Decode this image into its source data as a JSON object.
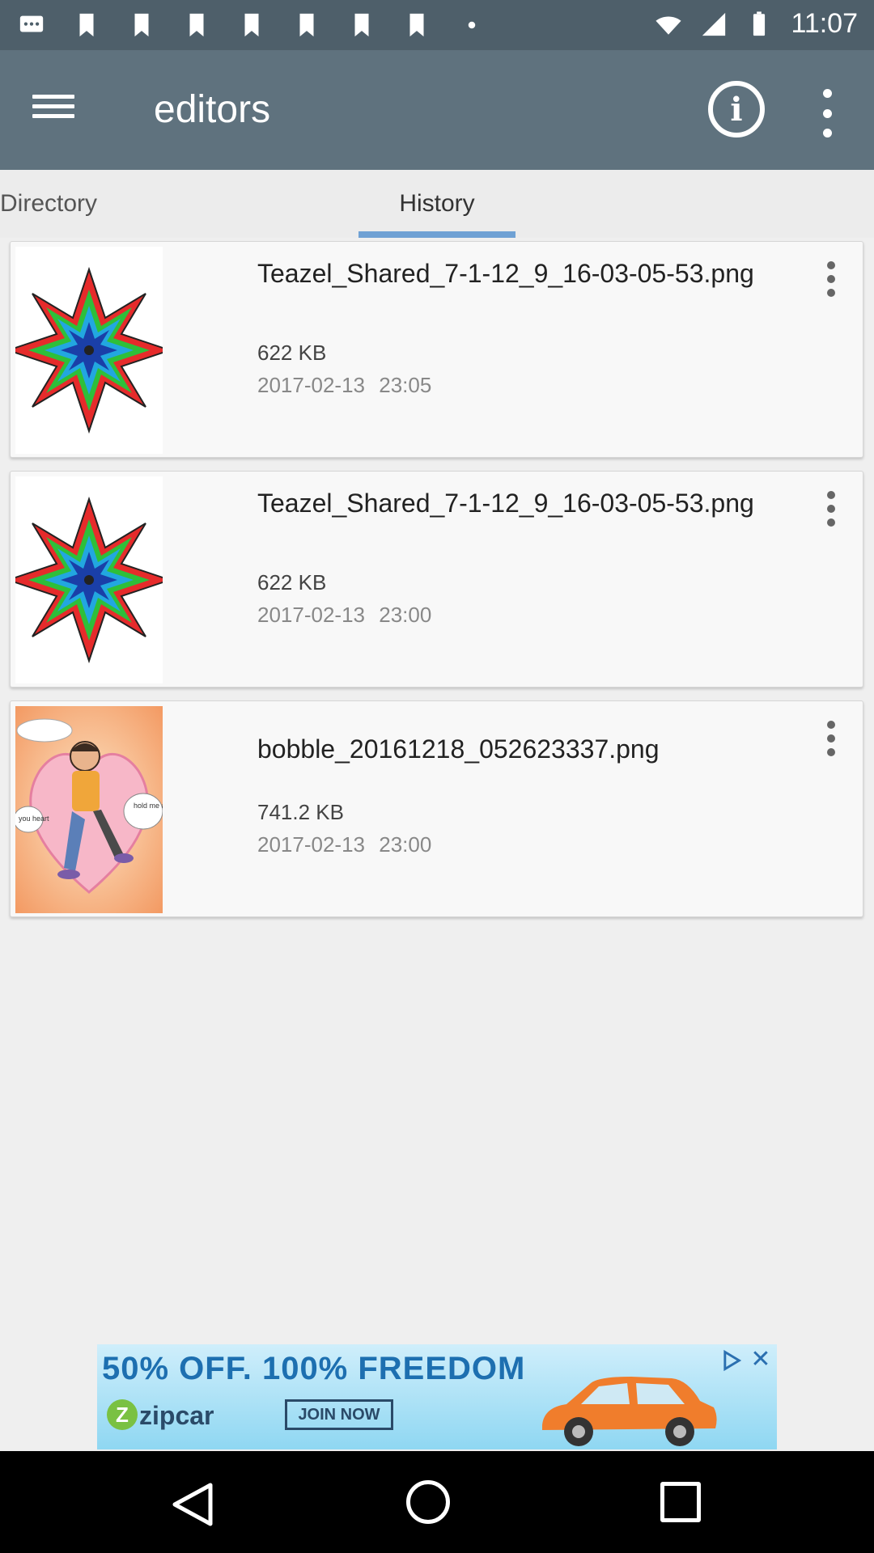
{
  "status_bar": {
    "time": "11:07"
  },
  "app_bar": {
    "title": "editors"
  },
  "tabs": [
    {
      "label": "Directory",
      "selected": false
    },
    {
      "label": "History",
      "selected": true
    }
  ],
  "history": [
    {
      "name": "Teazel_Shared_7-1-12_9_16-03-05-53.png",
      "size": "622 KB",
      "date": "2017-02-13",
      "time": "23:05",
      "thumbnail": "star-mandala"
    },
    {
      "name": "Teazel_Shared_7-1-12_9_16-03-05-53.png",
      "size": "622 KB",
      "date": "2017-02-13",
      "time": "23:00",
      "thumbnail": "star-mandala"
    },
    {
      "name": "bobble_20161218_052623337.png",
      "size": "741.2 KB",
      "date": "2017-02-13",
      "time": "23:00",
      "thumbnail": "cartoon-heart",
      "thumb_text_1": "hold me and neve",
      "thumb_text_2": "you heart"
    }
  ],
  "ad": {
    "headline": "50% OFF. 100% FREEDOM",
    "brand": "zipcar",
    "cta": "JOIN NOW",
    "colors": {
      "background": "#8fd7f2",
      "headline": "#1d6fb0",
      "car": "#f07d2c"
    }
  },
  "colors": {
    "status_bar": "#4e5f6a",
    "app_bar": "#5f727e",
    "tab_indicator": "#6fa1d4"
  }
}
